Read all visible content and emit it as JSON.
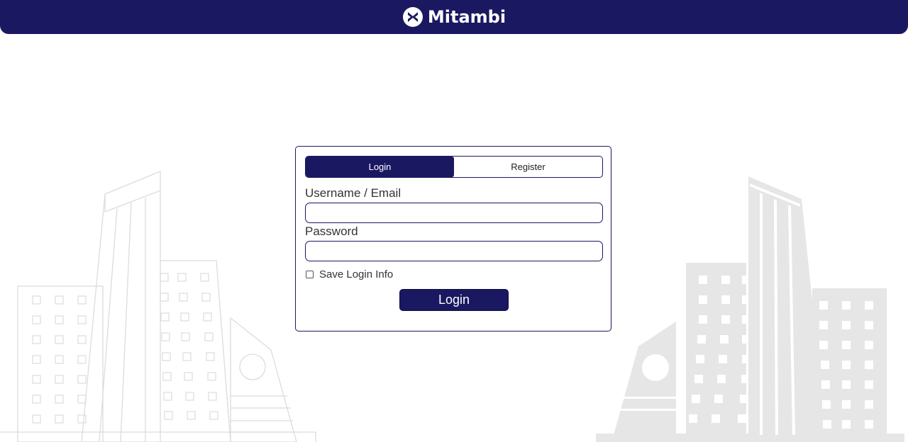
{
  "header": {
    "brand_name": "Mitambi",
    "brand_icon": "mitambi-logo-icon",
    "background": "#1b1862"
  },
  "tabs": [
    {
      "label": "Login",
      "active": true
    },
    {
      "label": "Register",
      "active": false
    }
  ],
  "form": {
    "username_label": "Username / Email",
    "username_value": "",
    "password_label": "Password",
    "password_value": "",
    "remember_label": "Save Login Info",
    "remember_checked": false,
    "submit_label": "Login"
  },
  "colors": {
    "accent": "#1b1862",
    "background_buildings_left": "#e3e3e3",
    "background_buildings_right": "#e6e6e6"
  }
}
